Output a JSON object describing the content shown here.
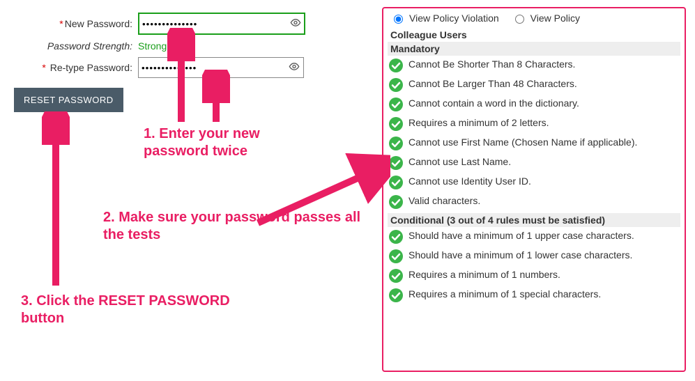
{
  "form": {
    "new_password_label": "New Password:",
    "new_password_value": "••••••••••••••",
    "strength_label": "Password Strength:",
    "strength_value": "Strong",
    "retype_label": "Re-type Password:",
    "retype_value": "••••••••••••••",
    "reset_button": "RESET PASSWORD"
  },
  "panel": {
    "radio_violation": "View Policy Violation",
    "radio_policy": "View Policy",
    "users_title": "Colleague Users",
    "mandatory_title": "Mandatory",
    "conditional_title": "Conditional (3 out of 4 rules must be satisfied)",
    "mandatory_rules": [
      "Cannot Be Shorter Than 8 Characters.",
      "Cannot Be Larger Than 48 Characters.",
      "Cannot contain a word in the dictionary.",
      "Requires a minimum of 2 letters.",
      "Cannot use First Name (Chosen Name if applicable).",
      "Cannot use Last Name.",
      "Cannot use Identity User ID.",
      "Valid characters."
    ],
    "conditional_rules": [
      "Should have a minimum of 1 upper case characters.",
      "Should have a minimum of 1 lower case characters.",
      "Requires a minimum of 1 numbers.",
      "Requires a minimum of 1 special characters."
    ]
  },
  "annotations": {
    "step1": "1. Enter your new password twice",
    "step2": "2. Make sure your password passes all the tests",
    "step3": "3. Click the RESET PASSWORD button"
  }
}
